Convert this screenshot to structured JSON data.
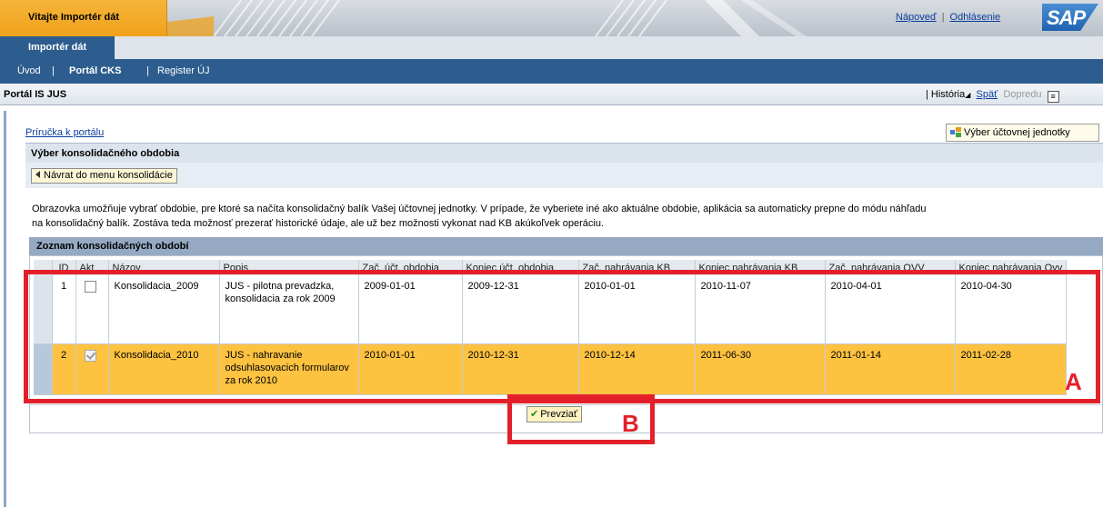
{
  "header": {
    "welcome": "Vitajte Importér dát",
    "links": [
      "Nápoveď",
      "Odhlásenie"
    ],
    "logo_text": "SAP"
  },
  "nav": {
    "active_tab": "Importér dát",
    "subnav": [
      "Úvod",
      "Portál CKS",
      "Register ÚJ"
    ]
  },
  "page": {
    "title": "Portál IS JUS",
    "history": "História",
    "back": "Späť",
    "forward": "Dopredu"
  },
  "content": {
    "manual_link": "Príručka k portálu",
    "unit_button": "Výber účtovnej jednotky",
    "panel_title": "Výber konsolidačného obdobia",
    "back_button": "Návrat do menu konsolidácie",
    "info_line1": "Obrazovka umožňuje vybrať obdobie, pre ktoré sa načíta konsolidačný balík Vašej účtovnej jednotky.  V prípade, že vyberiete iné ako aktuálne obdobie,  aplikácia sa automaticky prepne do módu náhľadu",
    "info_line2": "na konsolidačný balík. Zostáva teda možnosť  prezerať historické údaje, ale už bez možnosti vykonat nad KB akúkoľvek operáciu.",
    "list_title": "Zoznam konsolidačných období",
    "confirm_button": "Prevziať"
  },
  "table": {
    "columns": [
      "ID",
      "Akt",
      "Názov",
      "Popis",
      "Zač. účt. obdobia",
      "Koniec účt. obdobia",
      "Zač. nahrávania KB",
      "Koniec nahrávania KB",
      "Zač. nahrávania OVV",
      "Koniec nahrávania Ovv"
    ],
    "rows": [
      {
        "id": "1",
        "akt": false,
        "nazov": "Konsolidacia_2009",
        "popis": "JUS - pilotna prevadzka, konsolidacia za rok 2009",
        "zac_uct": "2009-01-01",
        "kon_uct": "2009-12-31",
        "zac_kb": "2010-01-01",
        "kon_kb": "2010-11-07",
        "zac_ovv": "2010-04-01",
        "kon_ovv": "2010-04-30"
      },
      {
        "id": "2",
        "akt": true,
        "nazov": "Konsolidacia_2010",
        "popis": "JUS - nahravanie odsuhlasovacich formularov za rok 2010",
        "zac_uct": "2010-01-01",
        "kon_uct": "2010-12-31",
        "zac_kb": "2010-12-14",
        "kon_kb": "2011-06-30",
        "zac_ovv": "2011-01-14",
        "kon_ovv": "2011-02-28"
      }
    ]
  },
  "annotations": {
    "a": "A",
    "b": "B"
  },
  "colors": {
    "accent_orange": "#f0a21c",
    "nav_blue": "#2d5d8e",
    "selected_row": "#fcc240",
    "annotation_red": "#e3202a"
  }
}
